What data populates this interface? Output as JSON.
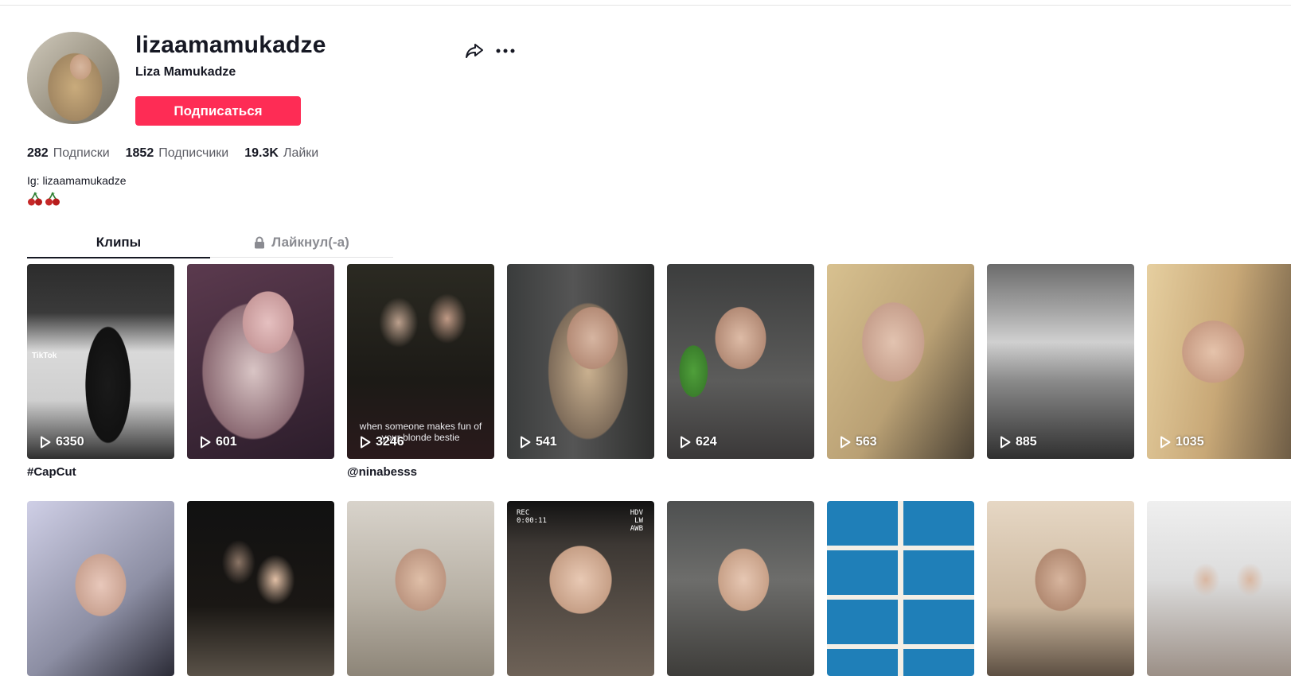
{
  "profile": {
    "username": "lizaamamukadze",
    "display_name": "Liza Mamukadze",
    "follow_label": "Подписаться",
    "bio_line": "Ig: lizaamamukadze",
    "bio_emoji": [
      "cherry-icon",
      "cherry-icon"
    ]
  },
  "stats": [
    {
      "value": "282",
      "label": "Подписки"
    },
    {
      "value": "1852",
      "label": "Подписчики"
    },
    {
      "value": "19.3K",
      "label": "Лайки"
    }
  ],
  "actions": {
    "share_icon": "share-icon",
    "more_icon": "more-icon"
  },
  "tabs": {
    "videos": "Клипы",
    "liked": "Лайкнул(-а)"
  },
  "videos_row1": [
    {
      "views": "6350",
      "caption": "#CapCut",
      "watermark": "TikTok"
    },
    {
      "views": "601",
      "caption": ""
    },
    {
      "views": "3246",
      "caption": "@ninabesss",
      "overlay": "when someone makes fun of your blonde bestie"
    },
    {
      "views": "541",
      "caption": ""
    },
    {
      "views": "624",
      "caption": ""
    },
    {
      "views": "563",
      "caption": ""
    },
    {
      "views": "885",
      "caption": ""
    },
    {
      "views": "1035",
      "caption": ""
    }
  ],
  "videos_row2": [
    {
      "views": ""
    },
    {
      "views": ""
    },
    {
      "views": ""
    },
    {
      "views": "",
      "rec": "REC",
      "timer": "0:00:11",
      "hdv": "HDV",
      "lw": "LW",
      "awb": "AWB"
    },
    {
      "views": ""
    },
    {
      "views": ""
    },
    {
      "views": ""
    },
    {
      "views": ""
    }
  ],
  "colors": {
    "accent": "#fe2c55",
    "text": "#161823",
    "muted": "#8a8b91"
  }
}
